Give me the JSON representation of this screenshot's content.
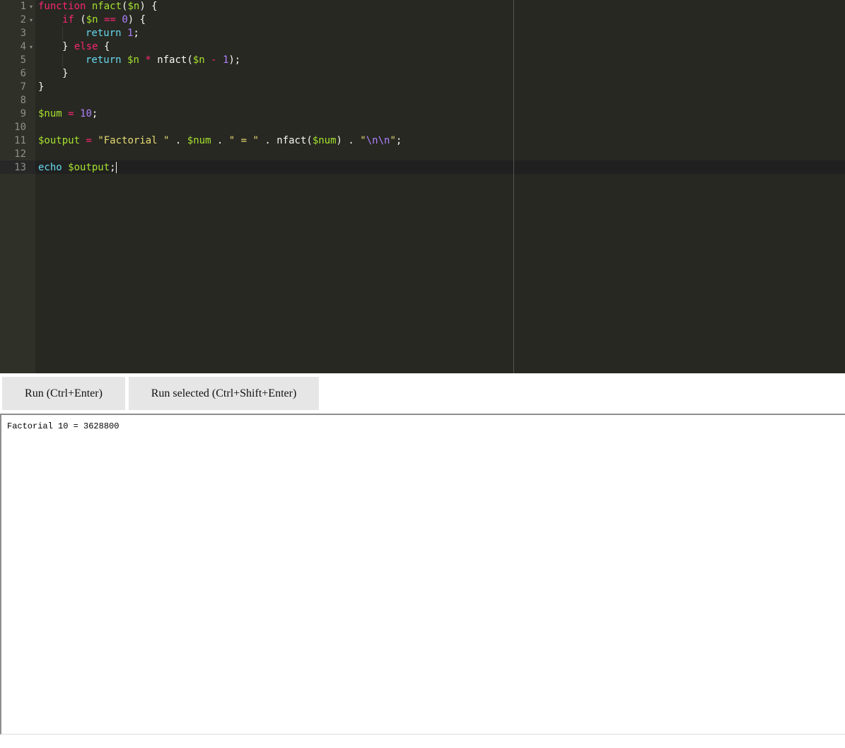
{
  "editor": {
    "line_numbers": [
      "1",
      "2",
      "3",
      "4",
      "5",
      "6",
      "7",
      "8",
      "9",
      "10",
      "11",
      "12",
      "13"
    ],
    "fold_marker": "▾",
    "lines": {
      "l1": {
        "kw_function": "function",
        "fn_name": "nfact",
        "p1": "(",
        "arg": "$n",
        "p2": ") {"
      },
      "l2": {
        "kw_if": "if",
        "p1": " (",
        "var": "$n",
        "sp": " ",
        "op": "==",
        "sp2": " ",
        "num": "0",
        "p2": ") {"
      },
      "l3": {
        "kw_return": "return",
        "sp": " ",
        "num": "1",
        "semi": ";"
      },
      "l4": {
        "p1": "} ",
        "kw_else": "else",
        "p2": " {"
      },
      "l5": {
        "kw_return": "return",
        "sp": " ",
        "var": "$n",
        "sp2": " ",
        "op_mul": "*",
        "sp3": " ",
        "call": "nfact(",
        "var2": "$n",
        "sp4": " ",
        "op_minus": "-",
        "sp5": " ",
        "num": "1",
        "p2": ");"
      },
      "l6": {
        "brace": "}"
      },
      "l7": {
        "brace": "}"
      },
      "l9": {
        "var": "$num",
        "sp": " ",
        "op": "=",
        "sp2": " ",
        "num": "10",
        "semi": ";"
      },
      "l11": {
        "var": "$output",
        "sp": " ",
        "op": "=",
        "sp2": " ",
        "str1": "\"Factorial \"",
        "dot1": " . ",
        "var2": "$num",
        "dot2": " . ",
        "str2": "\" = \"",
        "dot3": " . ",
        "call": "nfact(",
        "var3": "$num",
        "p1": ")",
        "dot4": " . ",
        "q1": "\"",
        "esc": "\\n\\n",
        "q2": "\"",
        "semi": ";"
      },
      "l13": {
        "kw_echo": "echo",
        "sp": " ",
        "var": "$output",
        "semi": ";"
      }
    }
  },
  "toolbar": {
    "run_label": "Run (Ctrl+Enter)",
    "run_selected_label": "Run selected (Ctrl+Shift+Enter)"
  },
  "output": {
    "text": "Factorial 10 = 3628800"
  },
  "colors": {
    "editor_bg": "#272822",
    "gutter_bg": "#2f3129",
    "keyword": "#f92672",
    "function": "#a6e22e",
    "number": "#ae81ff",
    "string": "#e6db74",
    "support": "#66d9ef",
    "button_bg": "#e6e6e6"
  }
}
